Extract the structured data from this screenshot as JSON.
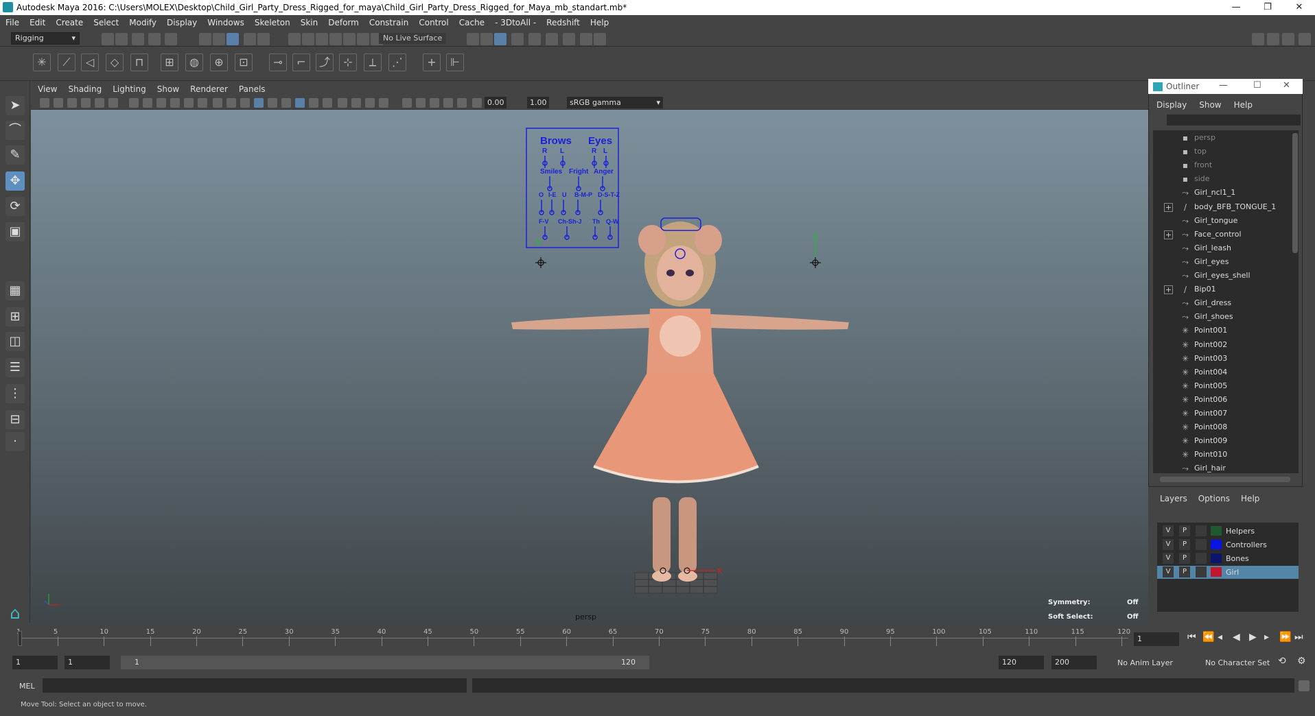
{
  "window": {
    "title": "Autodesk Maya 2016: C:\\Users\\MOLEX\\Desktop\\Child_Girl_Party_Dress_Rigged_for_maya\\Child_Girl_Party_Dress_Rigged_for_Maya_mb_standart.mb*",
    "minimize": "—",
    "restore": "❐",
    "close": "✕"
  },
  "menubar": [
    "File",
    "Edit",
    "Create",
    "Select",
    "Modify",
    "Display",
    "Windows",
    "Skeleton",
    "Skin",
    "Deform",
    "Constrain",
    "Control",
    "Cache",
    "- 3DtoAll -",
    "Redshift",
    "Help"
  ],
  "statusline": {
    "mode": "Rigging",
    "live_surface": "No Live Surface"
  },
  "panel_menu": [
    "View",
    "Shading",
    "Lighting",
    "Show",
    "Renderer",
    "Panels"
  ],
  "panel_bar": {
    "field_a": "0.00",
    "field_b": "1.00",
    "colorspace": "sRGB gamma"
  },
  "viewport": {
    "camera": "persp",
    "symmetry_label": "Symmetry:",
    "symmetry_value": "Off",
    "softselect_label": "Soft Select:",
    "softselect_value": "Off"
  },
  "face_rig": {
    "brows": "Brows",
    "eyes": "Eyes",
    "r": "R",
    "l": "L",
    "smiles": "Smiles",
    "fright": "Fright",
    "anger": "Anger",
    "o": "O",
    "ie": "I-E",
    "u": "U",
    "bmp": "B-M-P",
    "dstz": "D-S-T-Z",
    "fv": "F-V",
    "chshj": "Ch-Sh-J",
    "th": "Th",
    "qw": "Q-W",
    "y": "y",
    "x": "x"
  },
  "outliner": {
    "title": "Outliner",
    "menu": [
      "Display",
      "Show",
      "Help"
    ],
    "items": [
      {
        "label": "persp",
        "dim": true,
        "glyph": "▪",
        "plus": false
      },
      {
        "label": "top",
        "dim": true,
        "glyph": "▪",
        "plus": false
      },
      {
        "label": "front",
        "dim": true,
        "glyph": "▪",
        "plus": false
      },
      {
        "label": "side",
        "dim": true,
        "glyph": "▪",
        "plus": false
      },
      {
        "label": "Girl_ncl1_1",
        "dim": false,
        "glyph": "⤳",
        "plus": false
      },
      {
        "label": "body_BFB_TONGUE_1",
        "dim": false,
        "glyph": "∕",
        "plus": true
      },
      {
        "label": "Girl_tongue",
        "dim": false,
        "glyph": "⤳",
        "plus": false
      },
      {
        "label": "Face_control",
        "dim": false,
        "glyph": "⤳",
        "plus": true
      },
      {
        "label": "Girl_leash",
        "dim": false,
        "glyph": "⤳",
        "plus": false
      },
      {
        "label": "Girl_eyes",
        "dim": false,
        "glyph": "⤳",
        "plus": false
      },
      {
        "label": "Girl_eyes_shell",
        "dim": false,
        "glyph": "⤳",
        "plus": false
      },
      {
        "label": "Bip01",
        "dim": false,
        "glyph": "∕",
        "plus": true
      },
      {
        "label": "Girl_dress",
        "dim": false,
        "glyph": "⤳",
        "plus": false
      },
      {
        "label": "Girl_shoes",
        "dim": false,
        "glyph": "⤳",
        "plus": false
      },
      {
        "label": "Point001",
        "dim": false,
        "glyph": "✳",
        "plus": false
      },
      {
        "label": "Point002",
        "dim": false,
        "glyph": "✳",
        "plus": false
      },
      {
        "label": "Point003",
        "dim": false,
        "glyph": "✳",
        "plus": false
      },
      {
        "label": "Point004",
        "dim": false,
        "glyph": "✳",
        "plus": false
      },
      {
        "label": "Point005",
        "dim": false,
        "glyph": "✳",
        "plus": false
      },
      {
        "label": "Point006",
        "dim": false,
        "glyph": "✳",
        "plus": false
      },
      {
        "label": "Point007",
        "dim": false,
        "glyph": "✳",
        "plus": false
      },
      {
        "label": "Point008",
        "dim": false,
        "glyph": "✳",
        "plus": false
      },
      {
        "label": "Point009",
        "dim": false,
        "glyph": "✳",
        "plus": false
      },
      {
        "label": "Point010",
        "dim": false,
        "glyph": "✳",
        "plus": false
      },
      {
        "label": "Girl_hair",
        "dim": false,
        "glyph": "⤳",
        "plus": false
      }
    ]
  },
  "layers": {
    "menu": [
      "Layers",
      "Options",
      "Help"
    ],
    "rows": [
      {
        "v": "V",
        "p": "P",
        "name": "Helpers",
        "color": "#1f5a2e",
        "selected": false
      },
      {
        "v": "V",
        "p": "P",
        "name": "Controllers",
        "color": "#0a14e6",
        "selected": false
      },
      {
        "v": "V",
        "p": "P",
        "name": "Bones",
        "color": "#0c1470",
        "selected": false
      },
      {
        "v": "V",
        "p": "P",
        "name": "Girl",
        "color": "#c0182e",
        "selected": true
      }
    ]
  },
  "timeline": {
    "ticks": [
      "1",
      "5",
      "10",
      "15",
      "20",
      "25",
      "30",
      "35",
      "40",
      "45",
      "50",
      "55",
      "60",
      "65",
      "70",
      "75",
      "80",
      "85",
      "90",
      "95",
      "100",
      "105",
      "110",
      "115",
      "120"
    ],
    "current_frame": "1"
  },
  "range": {
    "start": "1",
    "playback_start": "1",
    "slider_start": "1",
    "slider_end": "120",
    "playback_end": "120",
    "end": "200",
    "anim_layer": "No Anim Layer",
    "character_set": "No Character Set"
  },
  "mel": {
    "label": "MEL"
  },
  "help": {
    "text": "Move Tool: Select an object to move."
  }
}
